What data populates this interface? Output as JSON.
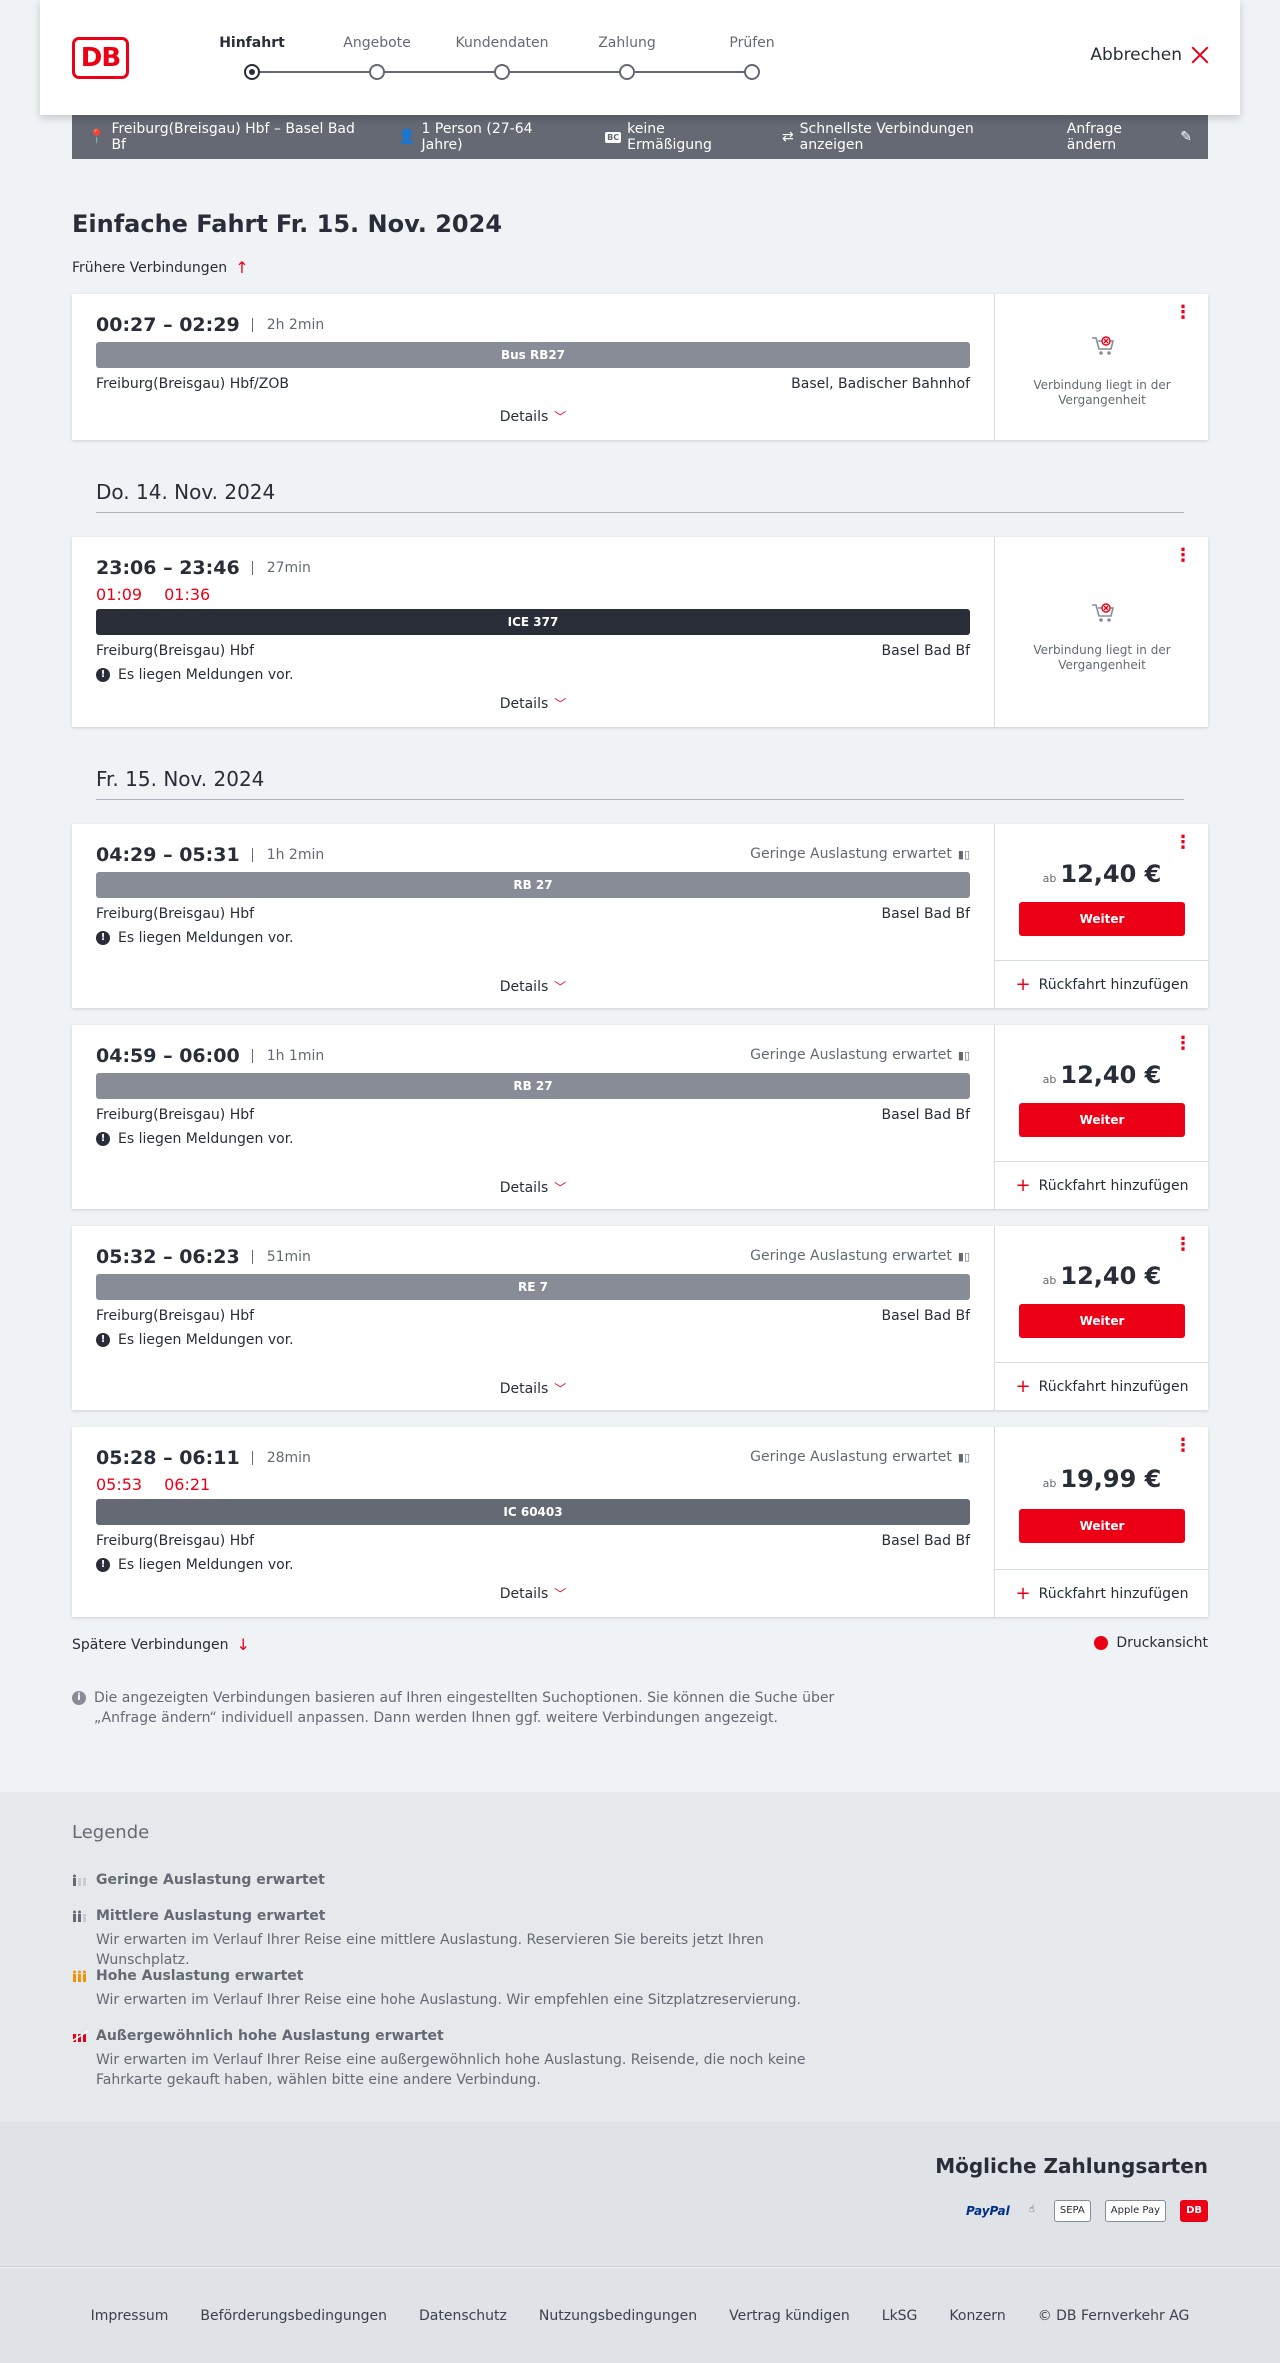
{
  "header": {
    "logo": "DB",
    "cancel": "Abbrechen",
    "steps": [
      "Hinfahrt",
      "Angebote",
      "Kundendaten",
      "Zahlung",
      "Prüfen"
    ]
  },
  "searchbar": {
    "route": "Freiburg(Breisgau) Hbf – Basel Bad Bf",
    "persons": "1 Person (27-64 Jahre)",
    "bc_badge": "BC",
    "discount": "keine Ermäßigung",
    "fastest": "Schnellste Verbindungen anzeigen",
    "change": "Anfrage ändern"
  },
  "heading": {
    "title": "Einfache Fahrt",
    "date": "Fr. 15. Nov. 2024"
  },
  "earlier": "Frühere Verbindungen",
  "later": "Spätere Verbindungen",
  "print": "Druckansicht",
  "details_label": "Details",
  "message": "Es liegen Meldungen vor.",
  "past_text": "Verbindung liegt in der Vergangenheit",
  "weiter": "Weiter",
  "rueckfahrt": "Rückfahrt hinzufügen",
  "price_prefix": "ab",
  "load_low": "Geringe Auslastung erwartet",
  "dates": [
    "Do. 14. Nov. 2024",
    "Fr. 15. Nov. 2024"
  ],
  "connections": [
    {
      "times": "00:27 – 02:29",
      "duration": "2h 2min",
      "train": "Bus RB27",
      "from": "Freiburg(Breisgau) Hbf/ZOB",
      "to": "Basel, Badischer Bahnhof"
    },
    {
      "times": "23:06 – 23:46",
      "duration": "27min",
      "delay_dep": "01:09",
      "delay_arr": "01:36",
      "train": "ICE 377",
      "from": "Freiburg(Breisgau) Hbf",
      "to": "Basel Bad Bf"
    },
    {
      "times": "04:29 – 05:31",
      "duration": "1h 2min",
      "train": "RB 27",
      "from": "Freiburg(Breisgau) Hbf",
      "to": "Basel Bad Bf",
      "price": "12,40 €"
    },
    {
      "times": "04:59 – 06:00",
      "duration": "1h 1min",
      "train": "RB 27",
      "from": "Freiburg(Breisgau) Hbf",
      "to": "Basel Bad Bf",
      "price": "12,40 €"
    },
    {
      "times": "05:32 – 06:23",
      "duration": "51min",
      "train": "RE 7",
      "from": "Freiburg(Breisgau) Hbf",
      "to": "Basel Bad Bf",
      "price": "12,40 €"
    },
    {
      "times": "05:28 – 06:11",
      "duration": "28min",
      "delay_dep": "05:53",
      "delay_arr": "06:21",
      "train": "IC 60403",
      "from": "Freiburg(Breisgau) Hbf",
      "to": "Basel Bad Bf",
      "price": "19,99 €"
    }
  ],
  "info_icon": "i",
  "info": "Die angezeigten Verbindungen basieren auf Ihren eingestellten Suchoptionen. Sie können die Suche über „Anfrage ändern“ individuell anpassen. Dann werden Ihnen ggf. weitere Verbindungen angezeigt.",
  "legend": {
    "title": "Legende",
    "items": [
      {
        "title": "Geringe Auslastung erwartet",
        "text": ""
      },
      {
        "title": "Mittlere Auslastung erwartet",
        "text": "Wir erwarten im Verlauf Ihrer Reise eine mittlere Auslastung. Reservieren Sie bereits jetzt Ihren Wunschplatz."
      },
      {
        "title": "Hohe Auslastung erwartet",
        "text": "Wir erwarten im Verlauf Ihrer Reise eine hohe Auslastung. Wir empfehlen eine Sitzplatzreservierung."
      },
      {
        "title": "Außergewöhnlich hohe Auslastung erwartet",
        "text": "Wir erwarten im Verlauf Ihrer Reise eine außergewöhnlich hohe Auslastung. Reisende, die noch keine Fahrkarte gekauft haben, wählen bitte eine andere Verbindung."
      }
    ]
  },
  "payment": {
    "title": "Mögliche Zahlungsarten",
    "methods": [
      "PayPal",
      "Kreditkarte",
      "SEPA",
      "Apple Pay",
      "DB"
    ]
  },
  "footer": [
    "Impressum",
    "Beförderungsbedingungen",
    "Datenschutz",
    "Nutzungsbedingungen",
    "Vertrag kündigen",
    "LkSG",
    "Konzern",
    "© DB Fernverkehr AG"
  ],
  "colors": {
    "brand": "#ec0016",
    "text": "#282d37",
    "bar": "#646973"
  }
}
